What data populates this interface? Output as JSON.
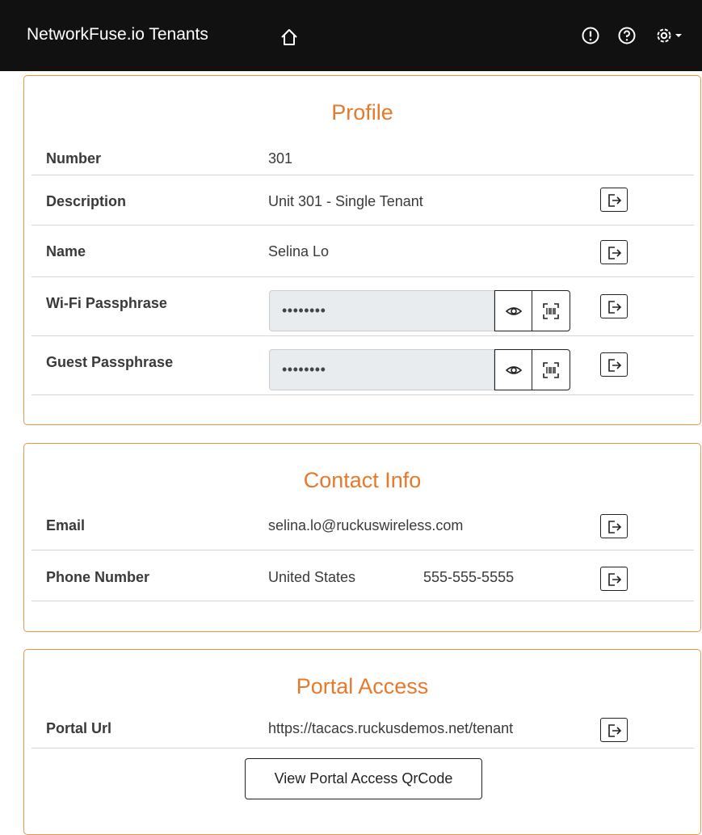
{
  "header": {
    "title": "NetworkFuse.io Tenants",
    "icons": [
      "home-icon",
      "alert-icon",
      "help-icon",
      "settings-icon",
      "caret-down-icon"
    ]
  },
  "colors": {
    "header_bg": "#111111",
    "accent": "#e7792b",
    "card_border": "#e8974a",
    "input_bg": "#e9ecef"
  },
  "profile": {
    "title": "Profile",
    "number": {
      "label": "Number",
      "value": "301"
    },
    "description": {
      "label": "Description",
      "value": "Unit 301 - Single Tenant"
    },
    "name": {
      "label": "Name",
      "value": "Selina Lo"
    },
    "wifi": {
      "label": "Wi-Fi Passphrase",
      "value": "••••••••"
    },
    "guest": {
      "label": "Guest Passphrase",
      "value": "••••••••"
    }
  },
  "contact": {
    "title": "Contact Info",
    "email": {
      "label": "Email",
      "value": "selina.lo@ruckuswireless.com"
    },
    "phone": {
      "label": "Phone Number",
      "country": "United States",
      "value": "555-555-5555"
    }
  },
  "portal": {
    "title": "Portal Access",
    "url": {
      "label": "Portal Url",
      "value": "https://tacacs.ruckusdemos.net/tenant"
    },
    "qr_button_label": "View Portal Access QrCode"
  }
}
